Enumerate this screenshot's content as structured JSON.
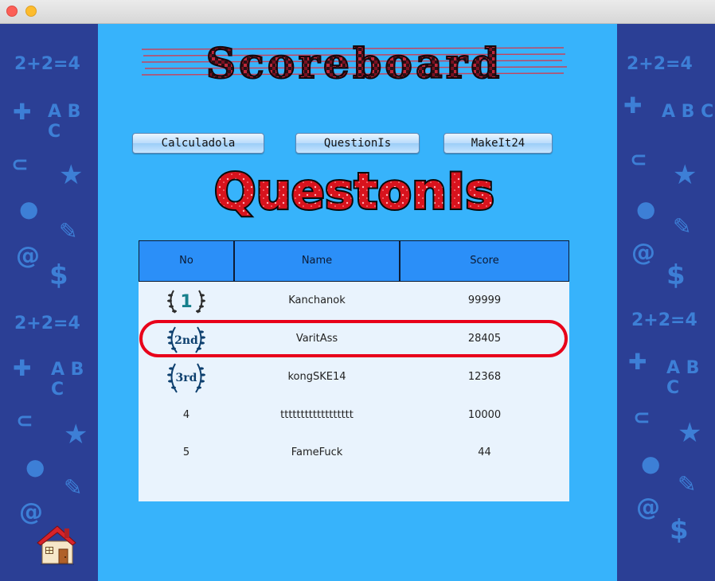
{
  "window": {
    "close_label": "",
    "minimize_label": ""
  },
  "header": {
    "title": "Scoreboard"
  },
  "games": [
    {
      "label": "Calculadola"
    },
    {
      "label": "QuestionIs"
    },
    {
      "label": "MakeIt24"
    }
  ],
  "selected_game_title": "QuestonIs",
  "table": {
    "columns": [
      "No",
      "Name",
      "Score"
    ],
    "rows": [
      {
        "no": "1",
        "medal": "1",
        "name": "Kanchanok",
        "score": "99999"
      },
      {
        "no": "2nd",
        "medal": "2nd",
        "name": "VaritAss",
        "score": "28405"
      },
      {
        "no": "3rd",
        "medal": "3rd",
        "name": "kongSKE14",
        "score": "12368"
      },
      {
        "no": "4",
        "name": "tttttttttttttttttt",
        "score": "10000"
      },
      {
        "no": "5",
        "name": "FameFuck",
        "score": "44"
      }
    ]
  },
  "decor": {
    "math_text": "2+2=4",
    "abc_text": "A B C",
    "dollar": "$"
  },
  "colors": {
    "side_panel": "#2b3f95",
    "main_bg": "#37b3fb",
    "header_cell": "#2b8ff8",
    "highlight": "#e8001a"
  }
}
